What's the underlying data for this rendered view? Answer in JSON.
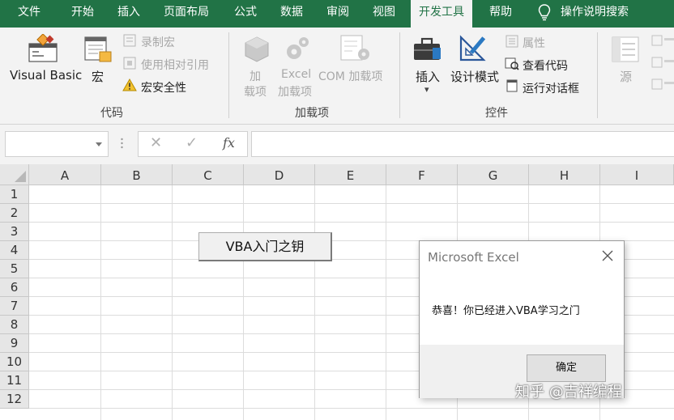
{
  "tabs": [
    "文件",
    "开始",
    "插入",
    "页面布局",
    "公式",
    "数据",
    "审阅",
    "视图",
    "开发工具",
    "帮助"
  ],
  "active_tab": "开发工具",
  "tell_me": "操作说明搜索",
  "ribbon": {
    "code_group": {
      "label": "代码",
      "visual_basic": "Visual Basic",
      "macros": "宏",
      "record_macro": "录制宏",
      "relative_refs": "使用相对引用",
      "macro_security": "宏安全性"
    },
    "addins_group": {
      "label": "加载项",
      "addins": [
        "加",
        "载项"
      ],
      "excel_addins": [
        "Excel",
        "加载项"
      ],
      "com_addins": "COM 加载项"
    },
    "controls_group": {
      "label": "控件",
      "insert": "插入",
      "design_mode": "设计模式",
      "properties": "属性",
      "view_code": "查看代码",
      "run_dialog": "运行对话框"
    },
    "xml_group": {
      "source": "源"
    }
  },
  "formula_bar": {
    "name_box": "",
    "cancel": "✕",
    "enter": "✓",
    "fx": "fx",
    "value": ""
  },
  "columns": [
    "A",
    "B",
    "C",
    "D",
    "E",
    "F",
    "G",
    "H",
    "I"
  ],
  "rows": [
    "1",
    "2",
    "3",
    "4",
    "5",
    "6",
    "7",
    "8",
    "9",
    "10",
    "11",
    "12"
  ],
  "sheet_button": "VBA入门之钥",
  "dialog": {
    "title": "Microsoft Excel",
    "message": "恭喜！你已经进入VBA学习之门",
    "ok": "确定"
  },
  "watermark": "知乎 @吉祥编程",
  "colors": {
    "brand": "#217346",
    "ribbon_bg": "#f3f3f3"
  }
}
